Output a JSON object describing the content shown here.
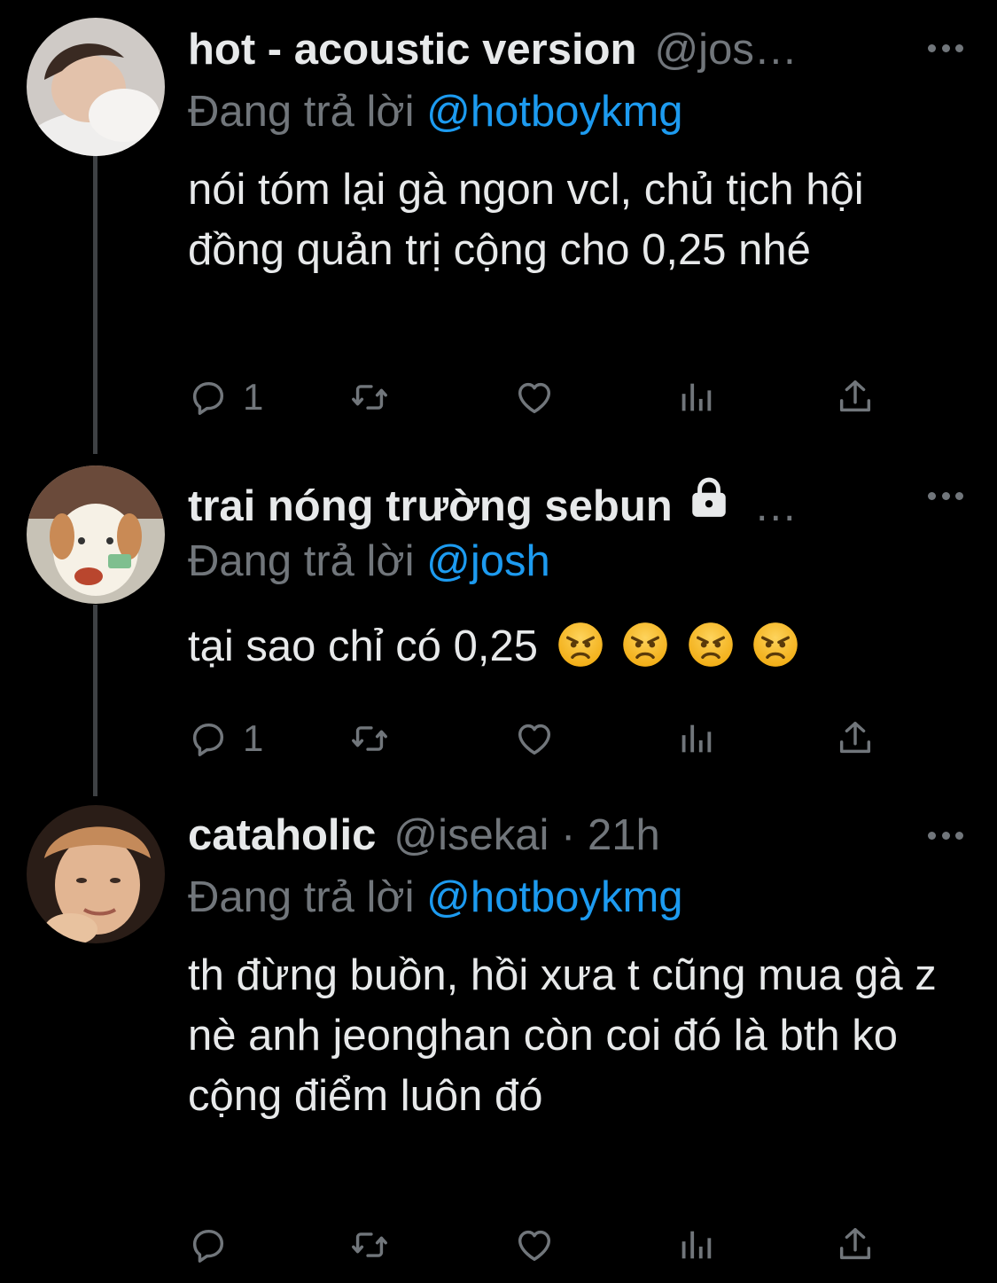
{
  "tweets": [
    {
      "name": "hot - acoustic version",
      "handle": "@jos…",
      "reply_prefix": "Đang trả lời",
      "reply_to": "@hotboykmg",
      "body": "nói tóm lại gà ngon vcl, chủ tịch hội đồng quản trị cộng cho 0,25 nhé",
      "reply_count": "1"
    },
    {
      "name": "trai nóng trường sebun",
      "handle_trail": "…",
      "locked": true,
      "reply_prefix": "Đang trả lời",
      "reply_to": "@josh",
      "body": "tại sao chỉ có 0,25",
      "emoji": "angry-face",
      "emoji_count": 4,
      "reply_count": "1"
    },
    {
      "name": "cataholic",
      "handle": "@isekai · 21h",
      "reply_prefix": "Đang trả lời",
      "reply_to": "@hotboykmg",
      "body": "th đừng buồn, hồi xưa t cũng mua gà z nè anh jeonghan còn coi đó là bth ko cộng điểm luôn đó",
      "reply_count": ""
    }
  ],
  "colors": {
    "background": "#000000",
    "text": "#e7e9ea",
    "muted": "#71767b",
    "link": "#1d9bf0"
  },
  "icons": [
    "reply-icon",
    "retweet-icon",
    "like-icon",
    "views-icon",
    "share-icon",
    "more-icon",
    "lock-icon"
  ]
}
